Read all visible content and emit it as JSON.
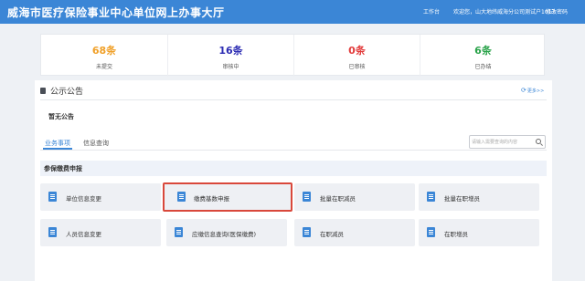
{
  "header": {
    "title": "威海市医疗保险事业中心单位网上办事大厅",
    "workbench": "工作台",
    "welcome": "欢迎您，山大地纬威海分公司测试户1017",
    "change_password": "修改密码"
  },
  "stats": [
    {
      "value": "68条",
      "label": "未提交",
      "color": "#f0a028"
    },
    {
      "value": "16条",
      "label": "审核中",
      "color": "#2d2db3"
    },
    {
      "value": "0条",
      "label": "已审核",
      "color": "#e23b3b"
    },
    {
      "value": "6条",
      "label": "已办结",
      "color": "#2aa34a"
    }
  ],
  "announcement": {
    "title": "公示公告",
    "more": "更多>>",
    "empty": "暂无公告"
  },
  "tabs": {
    "business": "业务事项",
    "info": "信息查询"
  },
  "search": {
    "placeholder": "请输入需要查询的内容"
  },
  "section": {
    "title": "参保缴费申报"
  },
  "cards": [
    {
      "label": "单位信息变更"
    },
    {
      "label": "缴费基数申报"
    },
    {
      "label": "批量在职减员"
    },
    {
      "label": "批量在职增员"
    },
    {
      "label": "人员信息变更"
    },
    {
      "label": "应缴信息查询(医保缴费)"
    },
    {
      "label": "在职减员"
    },
    {
      "label": "在职增员"
    }
  ]
}
